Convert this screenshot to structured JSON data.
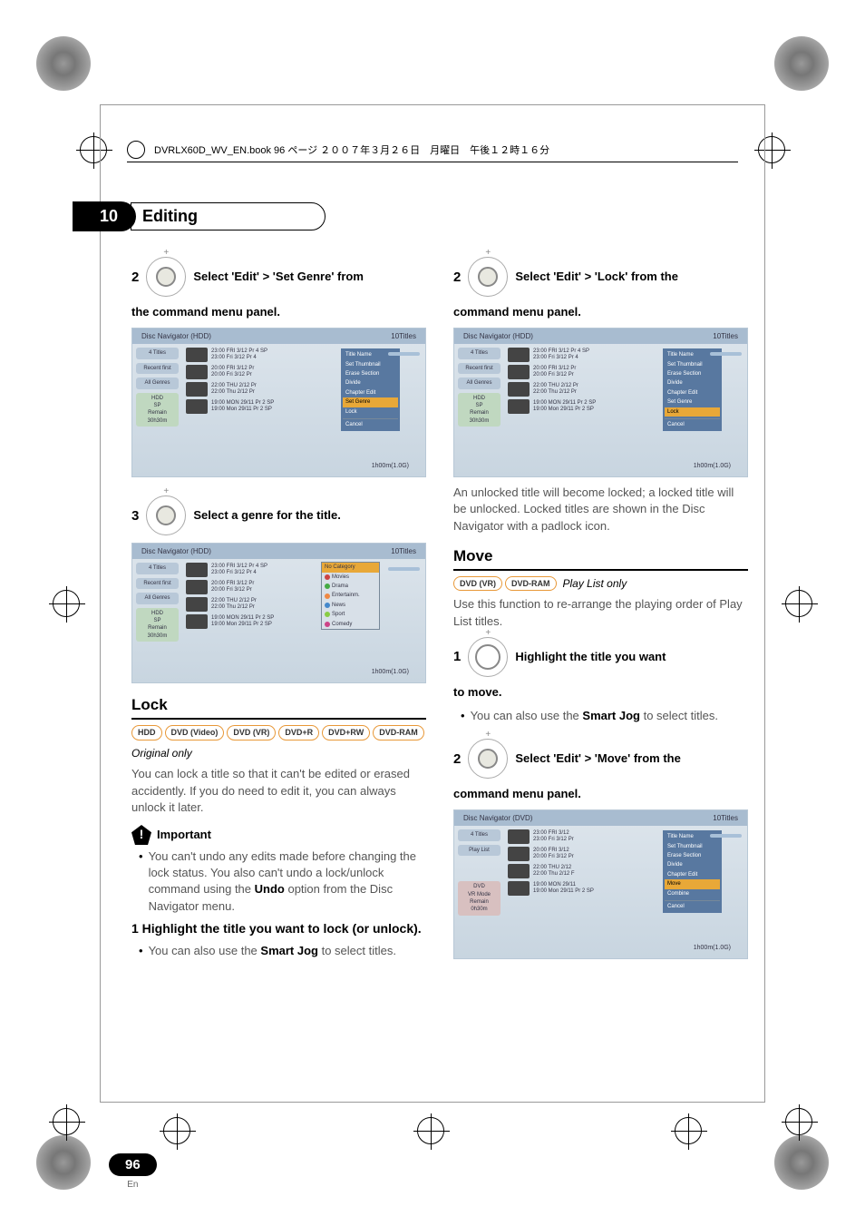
{
  "header_file": "DVRLX60D_WV_EN.book  96 ページ  ２００７年３月２６日　月曜日　午後１２時１６分",
  "chapter": {
    "num": "10",
    "title": "Editing"
  },
  "page": {
    "num": "96",
    "lang": "En"
  },
  "left": {
    "step2": {
      "num": "2",
      "text": "Select 'Edit' > 'Set Genre' from",
      "cont": "the command menu panel."
    },
    "step3": {
      "num": "3",
      "text": "Select a genre for the title."
    },
    "lock_title": "Lock",
    "lock_badges": [
      "HDD",
      "DVD (Video)",
      "DVD (VR)",
      "DVD+R",
      "DVD+RW",
      "DVD-RAM"
    ],
    "original_only": "Original only",
    "lock_body": "You can lock a title so that it can't be edited or erased accidently. If you do need to edit it, you can always unlock it later.",
    "important": "Important",
    "lock_bullet": "You can't undo any edits made before changing the lock status. You also can't undo a lock/unlock command using the ",
    "lock_bullet_bold": "Undo",
    "lock_bullet_end": " option from the Disc Navigator menu.",
    "lock_step1": "1   Highlight the title you want to lock (or unlock).",
    "lock_sub_bullet_a": "You can also use the ",
    "lock_sub_bullet_b": "Smart Jog",
    "lock_sub_bullet_c": " to select titles."
  },
  "right": {
    "step2": {
      "num": "2",
      "text": "Select 'Edit' > 'Lock' from the",
      "cont": "command menu panel."
    },
    "unlocked_body": "An unlocked title will become locked; a locked title will be unlocked. Locked titles are shown in the Disc Navigator with a padlock icon.",
    "move_title": "Move",
    "move_badges": [
      "DVD (VR)",
      "DVD-RAM"
    ],
    "playlist_only": "Play List only",
    "move_body": "Use this function to re-arrange the playing order of Play List titles.",
    "move_step1": {
      "num": "1",
      "text": "Highlight the title you want",
      "cont": "to move."
    },
    "move_bullet_a": "You can also use the ",
    "move_bullet_b": "Smart Jog",
    "move_bullet_c": " to select titles.",
    "move_step2": {
      "num": "2",
      "text": "Select 'Edit' > 'Move' from the",
      "cont": "command menu panel."
    }
  },
  "ss": {
    "hdd_title": "Disc Navigator (HDD)",
    "dvd_title": "Disc Navigator (DVD)",
    "titles10": "10Titles",
    "sidebar": {
      "four_titles": "4 Titles",
      "recent": "Recent first",
      "genres": "All Genres",
      "playlist": "Play List",
      "hdd": "HDD",
      "sp": "SP",
      "remain": "Remain",
      "time": "30h30m",
      "dvd_mode": "DVD",
      "vr_mode": "VR Mode",
      "remain_dvd": "0h30m"
    },
    "rows": {
      "r1a": "23:00 FRI  3/12  Pr 4  SP",
      "r1b": "23:00  Fri  3/12  Pr 4",
      "r2a": "20:00 FRI  3/12  Pr",
      "r2b": "20:00   Fri  3/12  Pr",
      "r3a": "22:00 THU  2/12  Pr",
      "r3b": "22:00  Thu  2/12  Pr",
      "r4a": "19:00 MON 29/11  Pr 2  SP",
      "r4b": "19:00  Mon  29/11  Pr 2  SP",
      "r5a": "23:00 FRI  3/12",
      "r5b": "23:00  Fri  3/12  Pr",
      "r6a": "20:00 FRI  3/12",
      "r6b": "20:00  Fri  3/12  Pr",
      "r7a": "22:00 THU  2/12",
      "r7b": "22:00  Thu  2/12  F",
      "r8a": "19:00 MON 29/11",
      "r8b": "19:00  Mon  29/11  Pr 2  SP"
    },
    "menu": {
      "title_name": "Title Name",
      "set_thumbnail": "Set Thumbnail",
      "erase": "Erase Section",
      "divide": "Divide",
      "chapter_edit": "Chapter Edit",
      "set_genre": "Set Genre",
      "lock": "Lock",
      "move": "Move",
      "combine": "Combine",
      "cancel": "Cancel"
    },
    "genre": {
      "no_cat": "No Category",
      "movies": "Movies",
      "drama": "Drama",
      "entertain": "Entertainm.",
      "news": "News",
      "sport": "Sport",
      "comedy": "Comedy"
    },
    "footer": "1h00m(1.0G)"
  }
}
